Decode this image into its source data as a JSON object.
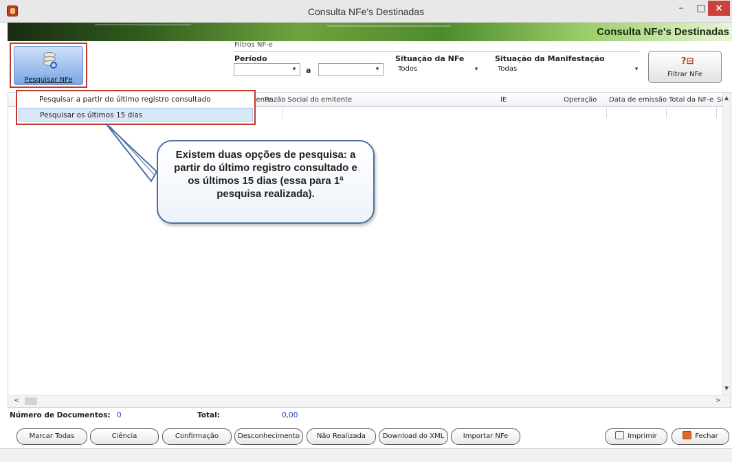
{
  "window": {
    "title": "Consulta NFe's Destinadas",
    "minimize": "–",
    "maximize": "□",
    "close": "×"
  },
  "banner": {
    "title": "Consulta NFe's Destinadas"
  },
  "toolbar": {
    "pesquisar_label": "Pesquisar NFe",
    "filtro_legend": "Filtros NF-e",
    "periodo_label": "Período",
    "periodo_from": "",
    "periodo_to": "",
    "a_label": "a",
    "situacao_nfe_label": "Situação da NFe",
    "situacao_nfe_value": "Todos",
    "situacao_manifest_label": "Situação da Manifestação",
    "situacao_manifest_value": "Todas",
    "filtrar_label": "Filtrar NFe",
    "filtrar_icon": "?⊟"
  },
  "menu": {
    "items": [
      "Pesquisar a partir do último registro consultado",
      "Pesquisar os últimos 15 dias"
    ]
  },
  "grid": {
    "columns": [
      "mitente",
      "Razão Social do emitente",
      "IE",
      "Operação",
      "Data de emissão",
      "Total da NF-e",
      "Si"
    ]
  },
  "callout": {
    "text": "Existem duas opções de pesquisa: a partir do último registro consultado e os últimos 15 dias (essa para 1ª pesquisa realizada)."
  },
  "footer": {
    "num_docs_label": "Número de Documentos:",
    "num_docs_value": "0",
    "total_label": "Total:",
    "total_value": "0,00"
  },
  "buttons": {
    "marcar_todas": "Marcar Todas",
    "ciencia": "Ciência",
    "confirmacao": "Confirmação",
    "desconhecimento": "Desconhecimento",
    "nao_realizada": "Não Realizada",
    "download_xml": "Download do XML",
    "importar_nfe": "Importar NFe",
    "imprimir": "Imprimir",
    "fechar": "Fechar"
  },
  "colors": {
    "accent_red": "#c0392b",
    "banner_green": "#4f8a2c",
    "callout_border": "#4a6fa5"
  }
}
